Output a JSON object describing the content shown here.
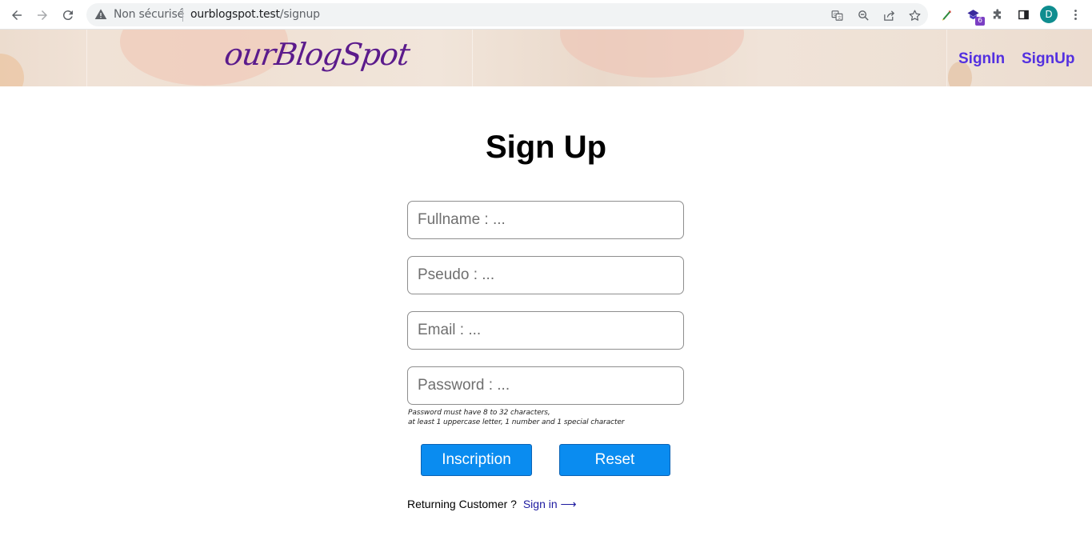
{
  "browser": {
    "security_label": "Non sécurisé",
    "url_host": "ourblogspot.test",
    "url_path": "/signup",
    "extension_badge": "6",
    "profile_initial": "D",
    "icons": [
      "back-arrow-icon",
      "forward-arrow-icon",
      "reload-icon",
      "warning-icon",
      "translate-icon",
      "zoom-icon",
      "share-icon",
      "star-icon",
      "extension-icon",
      "puzzle-icon",
      "side-panel-icon",
      "kebab-menu-icon"
    ]
  },
  "header": {
    "logo": "ourBlogSpot",
    "nav": {
      "signin": "SignIn",
      "signup": "SignUp"
    }
  },
  "form": {
    "title": "Sign Up",
    "fields": {
      "fullname": {
        "placeholder": "Fullname : ..."
      },
      "pseudo": {
        "placeholder": "Pseudo : ..."
      },
      "email": {
        "placeholder": "Email : ..."
      },
      "password": {
        "placeholder": "Password : ..."
      }
    },
    "password_hint_line1": "Password must have 8 to 32 characters,",
    "password_hint_line2": "at least 1 uppercase letter, 1 number and 1 special character",
    "buttons": {
      "submit": "Inscription",
      "reset": "Reset"
    },
    "returning_text": "Returning Customer ?",
    "signin_link": "Sign in ⟶"
  },
  "colors": {
    "accent_button": "#0a8cf0",
    "nav_link": "#5330e0",
    "logo": "#5b1b8c",
    "link": "#1d1aa0"
  }
}
